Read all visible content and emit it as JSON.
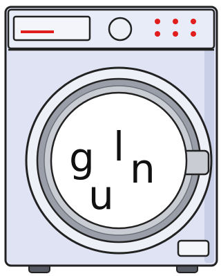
{
  "colors": {
    "body": "#dfe3f4",
    "panel": "#e8ebf8",
    "outline": "#222222",
    "door_ring": "#9a9ea8",
    "door_ring_light": "#c9ccd3",
    "glass": "#ffffff",
    "indicator_red": "#e11d1d",
    "feet": "#555a63"
  },
  "drum_letters": [
    "g",
    "u",
    "l",
    "n"
  ],
  "control_panel": {
    "display_indicator": "red-bar",
    "knob": "dial-knob",
    "buttons": 6
  }
}
